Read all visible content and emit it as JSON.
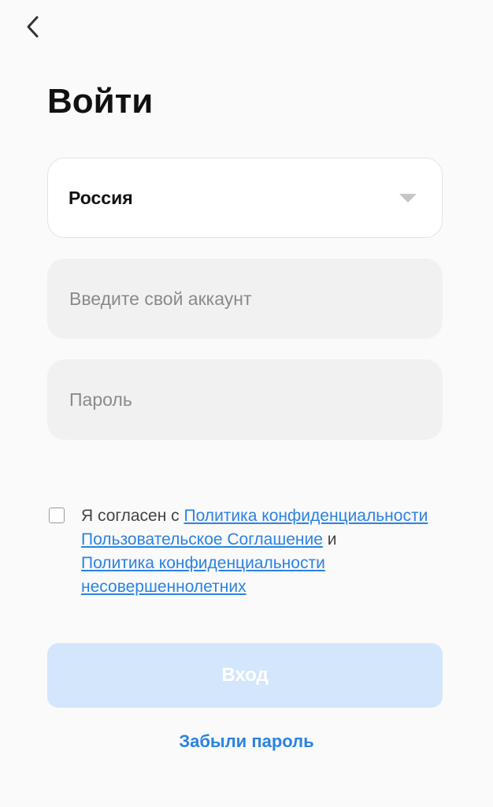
{
  "header": {
    "back_icon": "chevron-left-icon",
    "title": "Войти"
  },
  "form": {
    "country": {
      "value": "Россия",
      "icon": "caret-down-icon"
    },
    "account": {
      "value": "",
      "placeholder": "Введите свой аккаунт"
    },
    "password": {
      "value": "",
      "placeholder": "Пароль"
    }
  },
  "agreement": {
    "checked": false,
    "prefix": "Я согласен с ",
    "link_privacy": "Политика конфиденциальности",
    "link_user_agreement": "Пользовательское Соглашение",
    "connector": " и ",
    "link_minors_privacy": "Политика конфиденциальности несовершеннолетних"
  },
  "actions": {
    "login_label": "Вход",
    "forgot_label": "Забыли пароль"
  },
  "colors": {
    "background": "#fafafa",
    "accent": "#2a82e4",
    "button_disabled": "#d4e6fc",
    "input_bg": "#f1f1f1"
  }
}
